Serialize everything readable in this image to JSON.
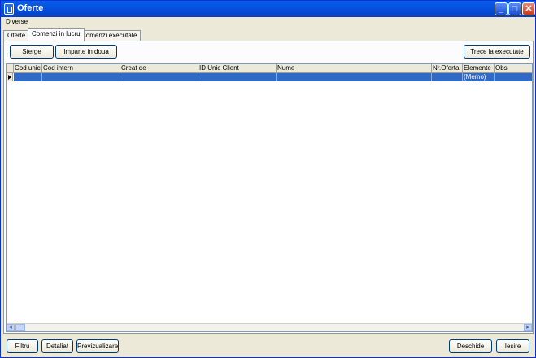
{
  "window": {
    "title": "Oferte"
  },
  "titlebar_buttons": {
    "minimize": "_",
    "maximize": "□",
    "close": "✕"
  },
  "menu": {
    "items": [
      "Diverse"
    ]
  },
  "tabs": [
    "Oferte",
    "Comenzi in lucru",
    "Comenzi executate"
  ],
  "active_tab": "Comenzi in lucru",
  "toolbar": {
    "delete_label": "Sterge",
    "split_label": "Imparte in doua",
    "move_label": "Trece la executate"
  },
  "grid": {
    "columns": [
      "Cod unic",
      "Cod intern",
      "Creat de",
      "ID Unic Client",
      "Nume",
      "Nr.Oferta",
      "Elemente",
      "Obs"
    ],
    "rows": [
      {
        "cod_unic": "",
        "cod_intern": "",
        "creat_de": "",
        "id_unic_client": "",
        "nume": "",
        "nr_oferta": "",
        "elemente": "(Memo)",
        "obs": ""
      }
    ]
  },
  "footer": {
    "filter_label": "Filtru",
    "detail_label": "Detaliat",
    "preview_label": "Previzualizare",
    "open_label": "Deschide",
    "exit_label": "Iesire"
  },
  "colors": {
    "titlebar": "#0553e2",
    "selected_row": "#316ac5",
    "window_bg": "#ece9d8"
  }
}
